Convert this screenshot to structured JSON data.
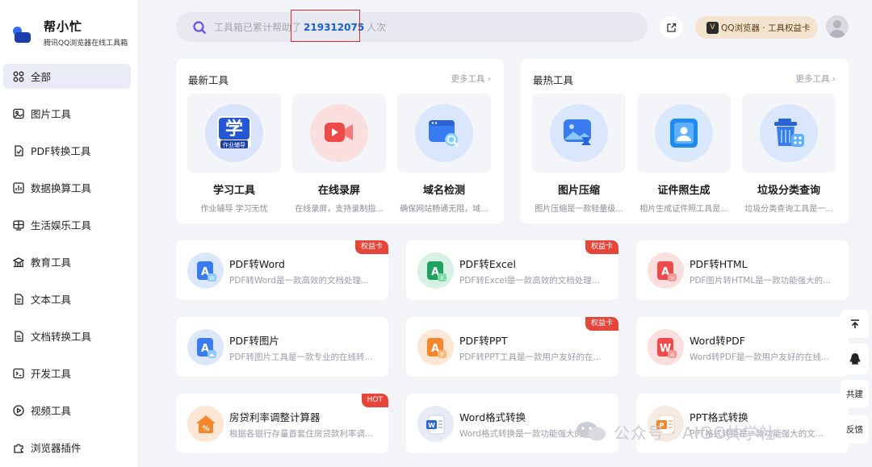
{
  "app": {
    "name": "帮小忙",
    "subtitle": "腾讯QQ浏览器在线工具箱"
  },
  "sidebar": {
    "items": [
      {
        "label": "全部",
        "icon": "grid-icon"
      },
      {
        "label": "图片工具",
        "icon": "image-icon"
      },
      {
        "label": "PDF转换工具",
        "icon": "pdf-icon"
      },
      {
        "label": "数据换算工具",
        "icon": "chart-icon"
      },
      {
        "label": "生活娱乐工具",
        "icon": "tv-icon"
      },
      {
        "label": "教育工具",
        "icon": "education-icon"
      },
      {
        "label": "文本工具",
        "icon": "text-icon"
      },
      {
        "label": "文档转换工具",
        "icon": "doc-convert-icon"
      },
      {
        "label": "开发工具",
        "icon": "terminal-icon"
      },
      {
        "label": "视频工具",
        "icon": "video-icon"
      },
      {
        "label": "浏览器插件",
        "icon": "plugin-icon"
      }
    ]
  },
  "search": {
    "prefix": "工具箱已累计帮助了",
    "count": "219312075",
    "suffix": "人次"
  },
  "promo": {
    "label": "QQ浏览器 · 工具权益卡"
  },
  "panels": {
    "newest": {
      "title": "最新工具",
      "more": "更多工具",
      "tiles": [
        {
          "name": "学习工具",
          "desc": "作业辅导 学习无忧",
          "icon_text": "学",
          "icon_sub": "作业辅导"
        },
        {
          "name": "在线录屏",
          "desc": "在线录屏，支持录制指..."
        },
        {
          "name": "域名检测",
          "desc": "确保网站畅通无阻，域..."
        }
      ]
    },
    "hottest": {
      "title": "最热工具",
      "more": "更多工具",
      "tiles": [
        {
          "name": "图片压缩",
          "desc": "图片压缩是一款轻量级..."
        },
        {
          "name": "证件照生成",
          "desc": "相片生成证件照工具是..."
        },
        {
          "name": "垃圾分类查询",
          "desc": "垃圾分类查询工具是一..."
        }
      ]
    }
  },
  "cards": [
    {
      "title": "PDF转Word",
      "desc": "PDF转Word是一款高效的文档处理...",
      "badge": "权益卡",
      "letter": "A",
      "sub": "W"
    },
    {
      "title": "PDF转Excel",
      "desc": "PDF转Excel是一款高效的文档处理...",
      "badge": "权益卡",
      "letter": "A",
      "sub": "X"
    },
    {
      "title": "PDF转HTML",
      "desc": "PDF图片转HTML是一款功能强大的...",
      "badge": "",
      "letter": "A",
      "sub": ">"
    },
    {
      "title": "PDF转图片",
      "desc": "PDF转图片工具是一款专业的在线转...",
      "badge": "",
      "letter": "A",
      "sub": ""
    },
    {
      "title": "PDF转PPT",
      "desc": "PDF转PPT工具是一款用户友好的在...",
      "badge": "权益卡",
      "letter": "A",
      "sub": "P"
    },
    {
      "title": "Word转PDF",
      "desc": "Word转PDF是一款用户友好的在线...",
      "badge": "",
      "letter": "W",
      "sub": "A"
    },
    {
      "title": "房贷利率调整计算器",
      "desc": "根据各银行存量首套住房贷款利率调...",
      "badge": "HOT",
      "letter": "%",
      "sub": ""
    },
    {
      "title": "Word格式转换",
      "desc": "Word格式转换是一款功能强大的文...",
      "badge": "",
      "letter": "W",
      "sub": ""
    },
    {
      "title": "PPT格式转换",
      "desc": "PPT格式转换是一款功能强大的文...",
      "badge": "",
      "letter": "P",
      "sub": ""
    }
  ],
  "float_toolbar": {
    "share_label": "共建",
    "feedback_label": "反馈"
  },
  "watermark": {
    "text": "公众号 · AIGC共学社"
  },
  "colors": {
    "accent": "#2e6cf6",
    "highlight_box": "#e0282e",
    "badge": "#e6453a",
    "promo_bg": "#f4e3ce"
  }
}
